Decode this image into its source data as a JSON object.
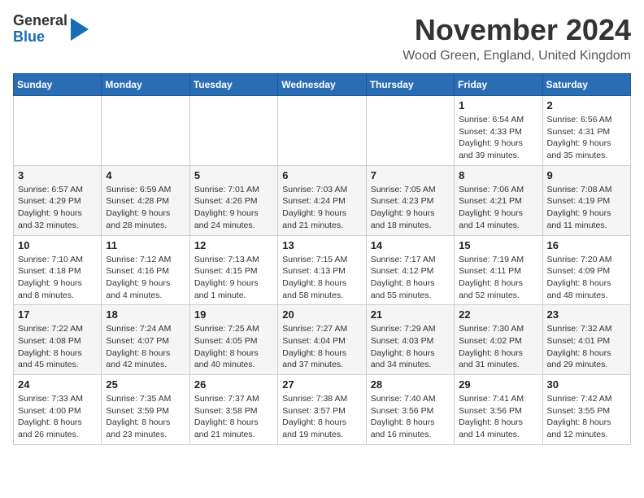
{
  "header": {
    "logo_line1": "General",
    "logo_line2": "Blue",
    "month": "November 2024",
    "location": "Wood Green, England, United Kingdom"
  },
  "weekdays": [
    "Sunday",
    "Monday",
    "Tuesday",
    "Wednesday",
    "Thursday",
    "Friday",
    "Saturday"
  ],
  "weeks": [
    [
      {
        "day": "",
        "info": ""
      },
      {
        "day": "",
        "info": ""
      },
      {
        "day": "",
        "info": ""
      },
      {
        "day": "",
        "info": ""
      },
      {
        "day": "",
        "info": ""
      },
      {
        "day": "1",
        "info": "Sunrise: 6:54 AM\nSunset: 4:33 PM\nDaylight: 9 hours and 39 minutes."
      },
      {
        "day": "2",
        "info": "Sunrise: 6:56 AM\nSunset: 4:31 PM\nDaylight: 9 hours and 35 minutes."
      }
    ],
    [
      {
        "day": "3",
        "info": "Sunrise: 6:57 AM\nSunset: 4:29 PM\nDaylight: 9 hours and 32 minutes."
      },
      {
        "day": "4",
        "info": "Sunrise: 6:59 AM\nSunset: 4:28 PM\nDaylight: 9 hours and 28 minutes."
      },
      {
        "day": "5",
        "info": "Sunrise: 7:01 AM\nSunset: 4:26 PM\nDaylight: 9 hours and 24 minutes."
      },
      {
        "day": "6",
        "info": "Sunrise: 7:03 AM\nSunset: 4:24 PM\nDaylight: 9 hours and 21 minutes."
      },
      {
        "day": "7",
        "info": "Sunrise: 7:05 AM\nSunset: 4:23 PM\nDaylight: 9 hours and 18 minutes."
      },
      {
        "day": "8",
        "info": "Sunrise: 7:06 AM\nSunset: 4:21 PM\nDaylight: 9 hours and 14 minutes."
      },
      {
        "day": "9",
        "info": "Sunrise: 7:08 AM\nSunset: 4:19 PM\nDaylight: 9 hours and 11 minutes."
      }
    ],
    [
      {
        "day": "10",
        "info": "Sunrise: 7:10 AM\nSunset: 4:18 PM\nDaylight: 9 hours and 8 minutes."
      },
      {
        "day": "11",
        "info": "Sunrise: 7:12 AM\nSunset: 4:16 PM\nDaylight: 9 hours and 4 minutes."
      },
      {
        "day": "12",
        "info": "Sunrise: 7:13 AM\nSunset: 4:15 PM\nDaylight: 9 hours and 1 minute."
      },
      {
        "day": "13",
        "info": "Sunrise: 7:15 AM\nSunset: 4:13 PM\nDaylight: 8 hours and 58 minutes."
      },
      {
        "day": "14",
        "info": "Sunrise: 7:17 AM\nSunset: 4:12 PM\nDaylight: 8 hours and 55 minutes."
      },
      {
        "day": "15",
        "info": "Sunrise: 7:19 AM\nSunset: 4:11 PM\nDaylight: 8 hours and 52 minutes."
      },
      {
        "day": "16",
        "info": "Sunrise: 7:20 AM\nSunset: 4:09 PM\nDaylight: 8 hours and 48 minutes."
      }
    ],
    [
      {
        "day": "17",
        "info": "Sunrise: 7:22 AM\nSunset: 4:08 PM\nDaylight: 8 hours and 45 minutes."
      },
      {
        "day": "18",
        "info": "Sunrise: 7:24 AM\nSunset: 4:07 PM\nDaylight: 8 hours and 42 minutes."
      },
      {
        "day": "19",
        "info": "Sunrise: 7:25 AM\nSunset: 4:05 PM\nDaylight: 8 hours and 40 minutes."
      },
      {
        "day": "20",
        "info": "Sunrise: 7:27 AM\nSunset: 4:04 PM\nDaylight: 8 hours and 37 minutes."
      },
      {
        "day": "21",
        "info": "Sunrise: 7:29 AM\nSunset: 4:03 PM\nDaylight: 8 hours and 34 minutes."
      },
      {
        "day": "22",
        "info": "Sunrise: 7:30 AM\nSunset: 4:02 PM\nDaylight: 8 hours and 31 minutes."
      },
      {
        "day": "23",
        "info": "Sunrise: 7:32 AM\nSunset: 4:01 PM\nDaylight: 8 hours and 29 minutes."
      }
    ],
    [
      {
        "day": "24",
        "info": "Sunrise: 7:33 AM\nSunset: 4:00 PM\nDaylight: 8 hours and 26 minutes."
      },
      {
        "day": "25",
        "info": "Sunrise: 7:35 AM\nSunset: 3:59 PM\nDaylight: 8 hours and 23 minutes."
      },
      {
        "day": "26",
        "info": "Sunrise: 7:37 AM\nSunset: 3:58 PM\nDaylight: 8 hours and 21 minutes."
      },
      {
        "day": "27",
        "info": "Sunrise: 7:38 AM\nSunset: 3:57 PM\nDaylight: 8 hours and 19 minutes."
      },
      {
        "day": "28",
        "info": "Sunrise: 7:40 AM\nSunset: 3:56 PM\nDaylight: 8 hours and 16 minutes."
      },
      {
        "day": "29",
        "info": "Sunrise: 7:41 AM\nSunset: 3:56 PM\nDaylight: 8 hours and 14 minutes."
      },
      {
        "day": "30",
        "info": "Sunrise: 7:42 AM\nSunset: 3:55 PM\nDaylight: 8 hours and 12 minutes."
      }
    ]
  ]
}
